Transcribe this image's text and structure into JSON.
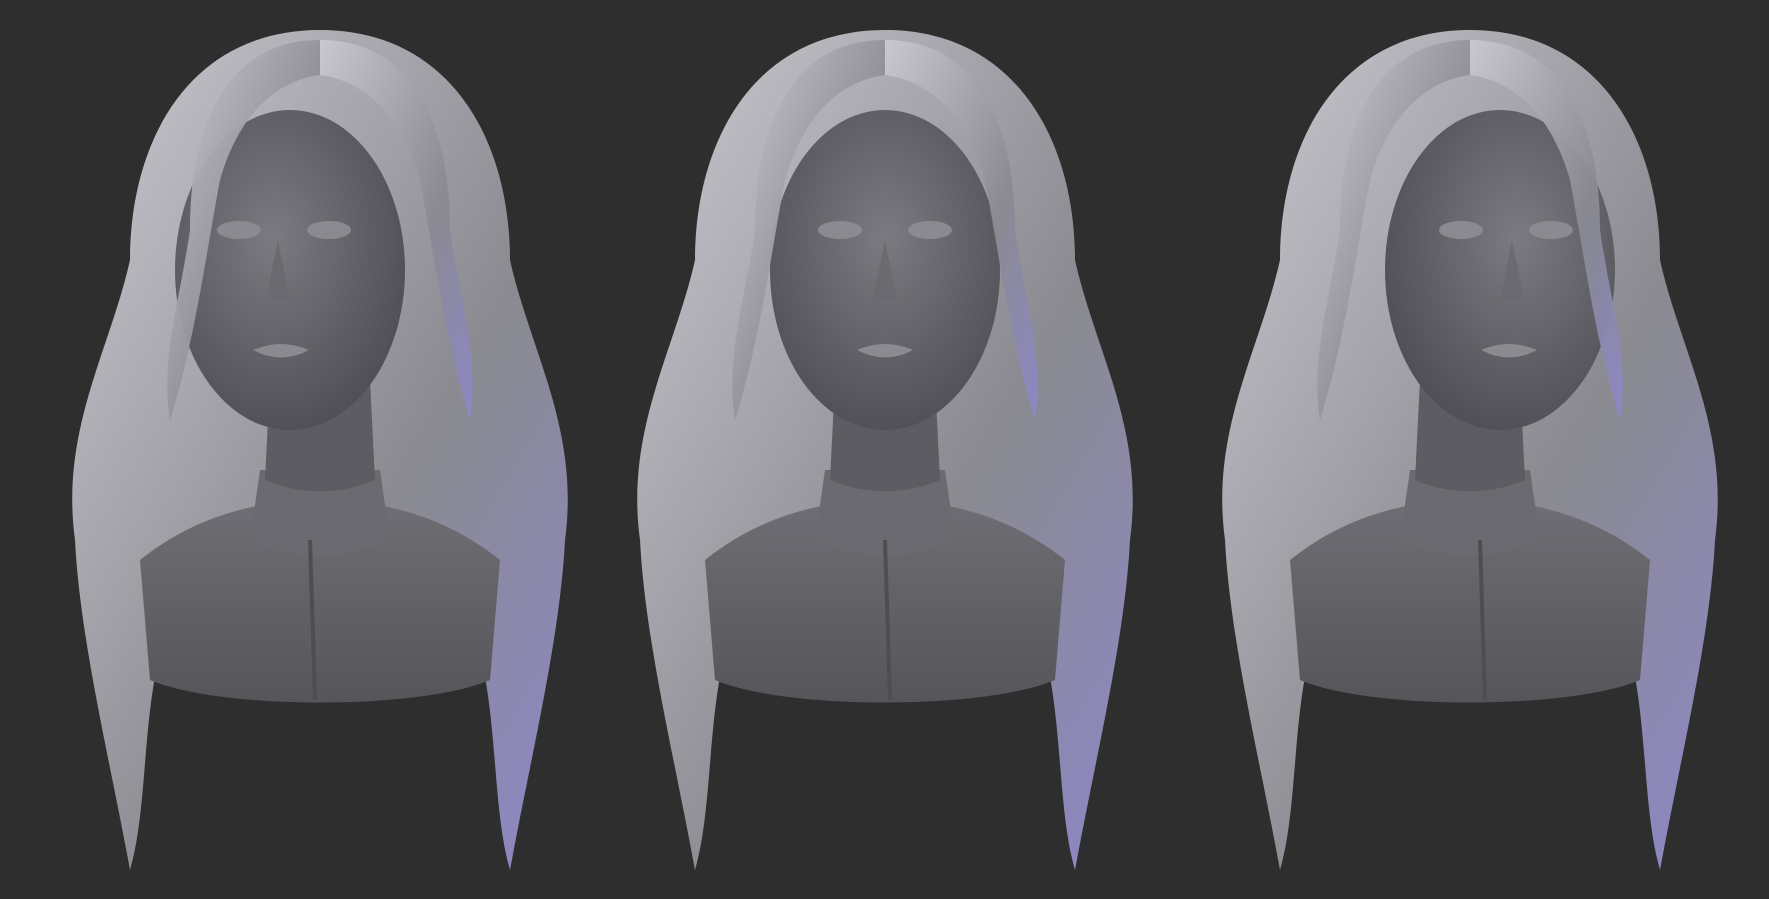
{
  "scene": {
    "background": "#2e2e2e",
    "clay_light": "#c9c9cf",
    "clay_mid": "#8a8a90",
    "clay_dark": "#4a4a50",
    "rim_tint": "#8c88c8",
    "views": [
      {
        "id": "left-three-quarter"
      },
      {
        "id": "front"
      },
      {
        "id": "right-three-quarter"
      }
    ]
  }
}
